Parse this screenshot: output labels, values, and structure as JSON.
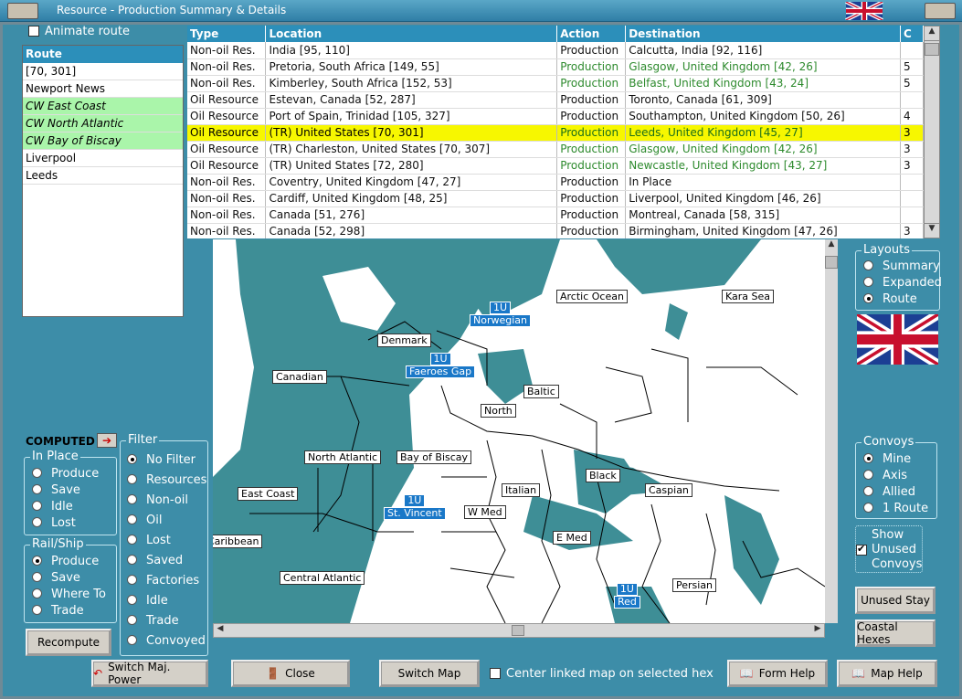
{
  "window": {
    "title": "Resource - Production Summary & Details"
  },
  "animate_route": {
    "label": "Animate route",
    "checked": false
  },
  "route_list": {
    "header": "Route",
    "items": [
      {
        "label": "[70, 301]",
        "highlight": false
      },
      {
        "label": "Newport News",
        "highlight": false
      },
      {
        "label": "CW East Coast",
        "highlight": true
      },
      {
        "label": "CW North Atlantic",
        "highlight": true
      },
      {
        "label": "CW Bay of Biscay",
        "highlight": true
      },
      {
        "label": "Liverpool",
        "highlight": false
      },
      {
        "label": "Leeds",
        "highlight": false
      }
    ]
  },
  "table": {
    "columns": [
      "Type",
      "Location",
      "Action",
      "Destination",
      "C"
    ],
    "rows": [
      {
        "type": "Non-oil Res.",
        "location": "India [95, 110]",
        "action": "Production",
        "destination": "Calcutta, India [92, 116]",
        "c": "",
        "state": "normal"
      },
      {
        "type": "Non-oil Res.",
        "location": "Pretoria, South Africa [149, 55]",
        "action": "Production",
        "destination": "Glasgow, United Kingdom [42, 26]",
        "c": "5",
        "state": "green"
      },
      {
        "type": "Non-oil Res.",
        "location": "Kimberley, South Africa [152, 53]",
        "action": "Production",
        "destination": "Belfast, United Kingdom [43, 24]",
        "c": "5",
        "state": "green"
      },
      {
        "type": "Oil Resource",
        "location": "Estevan, Canada [52, 287]",
        "action": "Production",
        "destination": "Toronto, Canada [61, 309]",
        "c": "",
        "state": "normal"
      },
      {
        "type": "Oil Resource",
        "location": "Port of Spain, Trinidad [105, 327]",
        "action": "Production",
        "destination": "Southampton, United Kingdom [50, 26]",
        "c": "4",
        "state": "normal"
      },
      {
        "type": "Oil Resource",
        "location": "(TR) United States [70, 301]",
        "action": "Production",
        "destination": "Leeds, United Kingdom [45, 27]",
        "c": "3",
        "state": "selected"
      },
      {
        "type": "Oil Resource",
        "location": "(TR) Charleston, United States [70, 307]",
        "action": "Production",
        "destination": "Glasgow, United Kingdom [42, 26]",
        "c": "3",
        "state": "green"
      },
      {
        "type": "Oil Resource",
        "location": "(TR) United States [72, 280]",
        "action": "Production",
        "destination": "Newcastle, United Kingdom [43, 27]",
        "c": "3",
        "state": "green"
      },
      {
        "type": "Non-oil Res.",
        "location": "Coventry, United Kingdom [47, 27]",
        "action": "Production",
        "destination": "In Place",
        "c": "",
        "state": "normal"
      },
      {
        "type": "Non-oil Res.",
        "location": "Cardiff, United Kingdom [48, 25]",
        "action": "Production",
        "destination": "Liverpool, United Kingdom [46, 26]",
        "c": "",
        "state": "normal"
      },
      {
        "type": "Non-oil Res.",
        "location": "Canada [51, 276]",
        "action": "Production",
        "destination": "Montreal, Canada [58, 315]",
        "c": "",
        "state": "normal"
      },
      {
        "type": "Non-oil Res.",
        "location": "Canada [52, 298]",
        "action": "Production",
        "destination": "Birmingham, United Kingdom [47, 26]",
        "c": "3",
        "state": "normal"
      }
    ]
  },
  "map": {
    "labels": [
      "Arctic Ocean",
      "Kara Sea",
      "Denmark",
      "Canadian",
      "Baltic",
      "North",
      "North Atlantic",
      "Bay of Biscay",
      "Black",
      "Italian",
      "Caspian",
      "East Coast",
      "W Med",
      "E Med",
      "Persian",
      "Central Atlantic",
      "Caribbean"
    ],
    "units": [
      {
        "count": "1U",
        "name": "Norwegian"
      },
      {
        "count": "1U",
        "name": "Faeroes Gap"
      },
      {
        "count": "1U",
        "name": "St. Vincent"
      },
      {
        "count": "1U",
        "name": "Red"
      }
    ]
  },
  "computed": {
    "label": "COMPUTED"
  },
  "in_place": {
    "title": "In Place",
    "options": [
      "Produce",
      "Save",
      "Idle",
      "Lost"
    ],
    "selected": ""
  },
  "rail_ship": {
    "title": "Rail/Ship",
    "options": [
      "Produce",
      "Save",
      "Where To",
      "Trade"
    ],
    "selected": "Produce"
  },
  "filter": {
    "title": "Filter",
    "options": [
      "No Filter",
      "Resources",
      "Non-oil",
      "Oil",
      "Lost",
      "Saved",
      "Factories",
      "Idle",
      "Trade",
      "Convoyed"
    ],
    "selected": "No Filter"
  },
  "layouts": {
    "title": "Layouts",
    "options": [
      "Summary",
      "Expanded",
      "Route"
    ],
    "selected": "Route"
  },
  "convoys": {
    "title": "Convoys",
    "options": [
      "Mine",
      "Axis",
      "Allied",
      "1 Route"
    ],
    "selected": "Mine"
  },
  "show_unused": {
    "label": "Show Unused Convoys",
    "checked": true
  },
  "buttons": {
    "recompute": "Recompute",
    "switch_power": "Switch Maj. Power",
    "close": "Close",
    "switch_map": "Switch Map",
    "center_linked": "Center linked map on selected hex",
    "form_help": "Form Help",
    "map_help": "Map Help",
    "unused_stay": "Unused  Stay",
    "coastal_hexes": "Coastal Hexes"
  },
  "colors": {
    "panel": "#3d8da8",
    "header": "#2c8fba",
    "sea": "#3e8e96",
    "selected_row": "#f7f700",
    "green_text": "#2d8a2d"
  }
}
